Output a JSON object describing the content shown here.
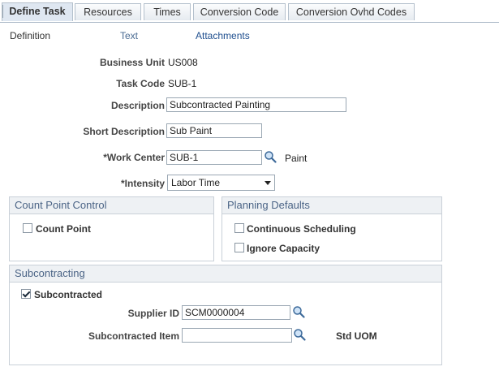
{
  "tabs": [
    {
      "label": "Define Task",
      "active": true
    },
    {
      "label": "Resources",
      "active": false
    },
    {
      "label": "Times",
      "active": false
    },
    {
      "label": "Conversion Code",
      "active": false
    },
    {
      "label": "Conversion Ovhd Codes",
      "active": false
    }
  ],
  "sublinks": {
    "definition": "Definition",
    "text": "Text",
    "attachments": "Attachments"
  },
  "form": {
    "business_unit_label": "Business Unit",
    "business_unit_value": "US008",
    "task_code_label": "Task Code",
    "task_code_value": "SUB-1",
    "description_label": "Description",
    "description_value": "Subcontracted Painting",
    "short_description_label": "Short Description",
    "short_description_value": "Sub Paint",
    "work_center_label": "*Work Center",
    "work_center_value": "SUB-1",
    "work_center_desc": "Paint",
    "intensity_label": "*Intensity",
    "intensity_value": "Labor Time"
  },
  "count_point_control": {
    "title": "Count Point Control",
    "count_point_label": "Count Point",
    "count_point_checked": false
  },
  "planning_defaults": {
    "title": "Planning Defaults",
    "continuous_scheduling_label": "Continuous Scheduling",
    "continuous_scheduling_checked": false,
    "ignore_capacity_label": "Ignore Capacity",
    "ignore_capacity_checked": false
  },
  "subcontracting": {
    "title": "Subcontracting",
    "subcontracted_label": "Subcontracted",
    "subcontracted_checked": true,
    "supplier_id_label": "Supplier ID",
    "supplier_id_value": "SCM0000004",
    "subcontracted_item_label": "Subcontracted Item",
    "subcontracted_item_value": "",
    "std_uom_label": "Std UOM"
  },
  "colors": {
    "group_header_text": "#4b6486",
    "link": "#1f4f8f",
    "tab_active_bg": "#dfe7f1"
  }
}
